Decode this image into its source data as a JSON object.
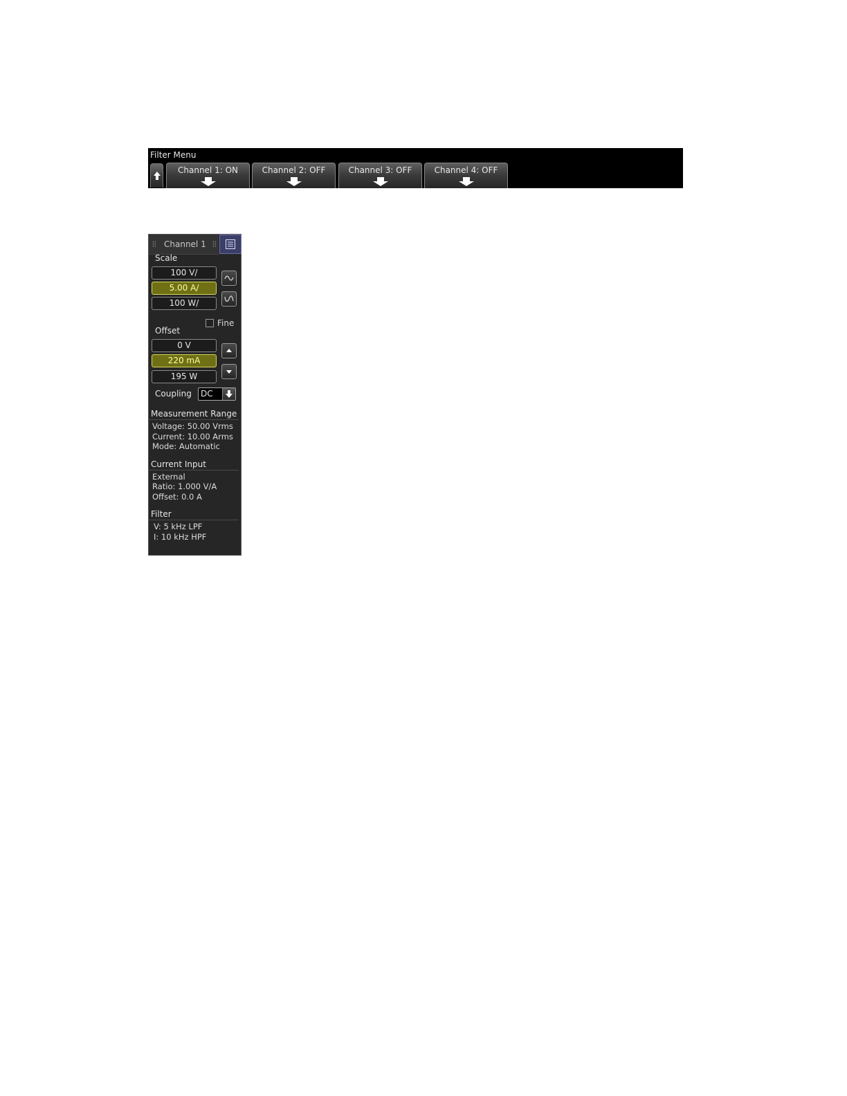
{
  "menu": {
    "title": "Filter Menu",
    "softkeys": [
      {
        "label": "Channel 1: ON"
      },
      {
        "label": "Channel 2: OFF"
      },
      {
        "label": "Channel 3: OFF"
      },
      {
        "label": "Channel 4: OFF"
      }
    ]
  },
  "panel": {
    "title": "Channel 1",
    "scale": {
      "label": "Scale",
      "values": [
        "100 V/",
        "5.00 A/",
        "100 W/"
      ],
      "active_index": 1
    },
    "fine_label": "Fine",
    "offset": {
      "label": "Offset",
      "values": [
        "0 V",
        "220 mA",
        "195 W"
      ],
      "active_index": 1
    },
    "coupling": {
      "label": "Coupling",
      "value": "DC"
    },
    "measurement_range": {
      "title": "Measurement Range",
      "lines": [
        "Voltage: 50.00 Vrms",
        "Current: 10.00 Arms",
        "Mode: Automatic"
      ]
    },
    "current_input": {
      "title": "Current Input",
      "lines": [
        "External",
        "Ratio:  1.000 V/A",
        "Offset: 0.0 A"
      ]
    },
    "filter": {
      "title": "Filter",
      "lines": [
        "V: 5 kHz LPF",
        "I: 10 kHz HPF"
      ]
    }
  },
  "colors": {
    "active_field": "#6f6f15",
    "menu_bg": "#000000",
    "panel_bg": "#262626"
  }
}
